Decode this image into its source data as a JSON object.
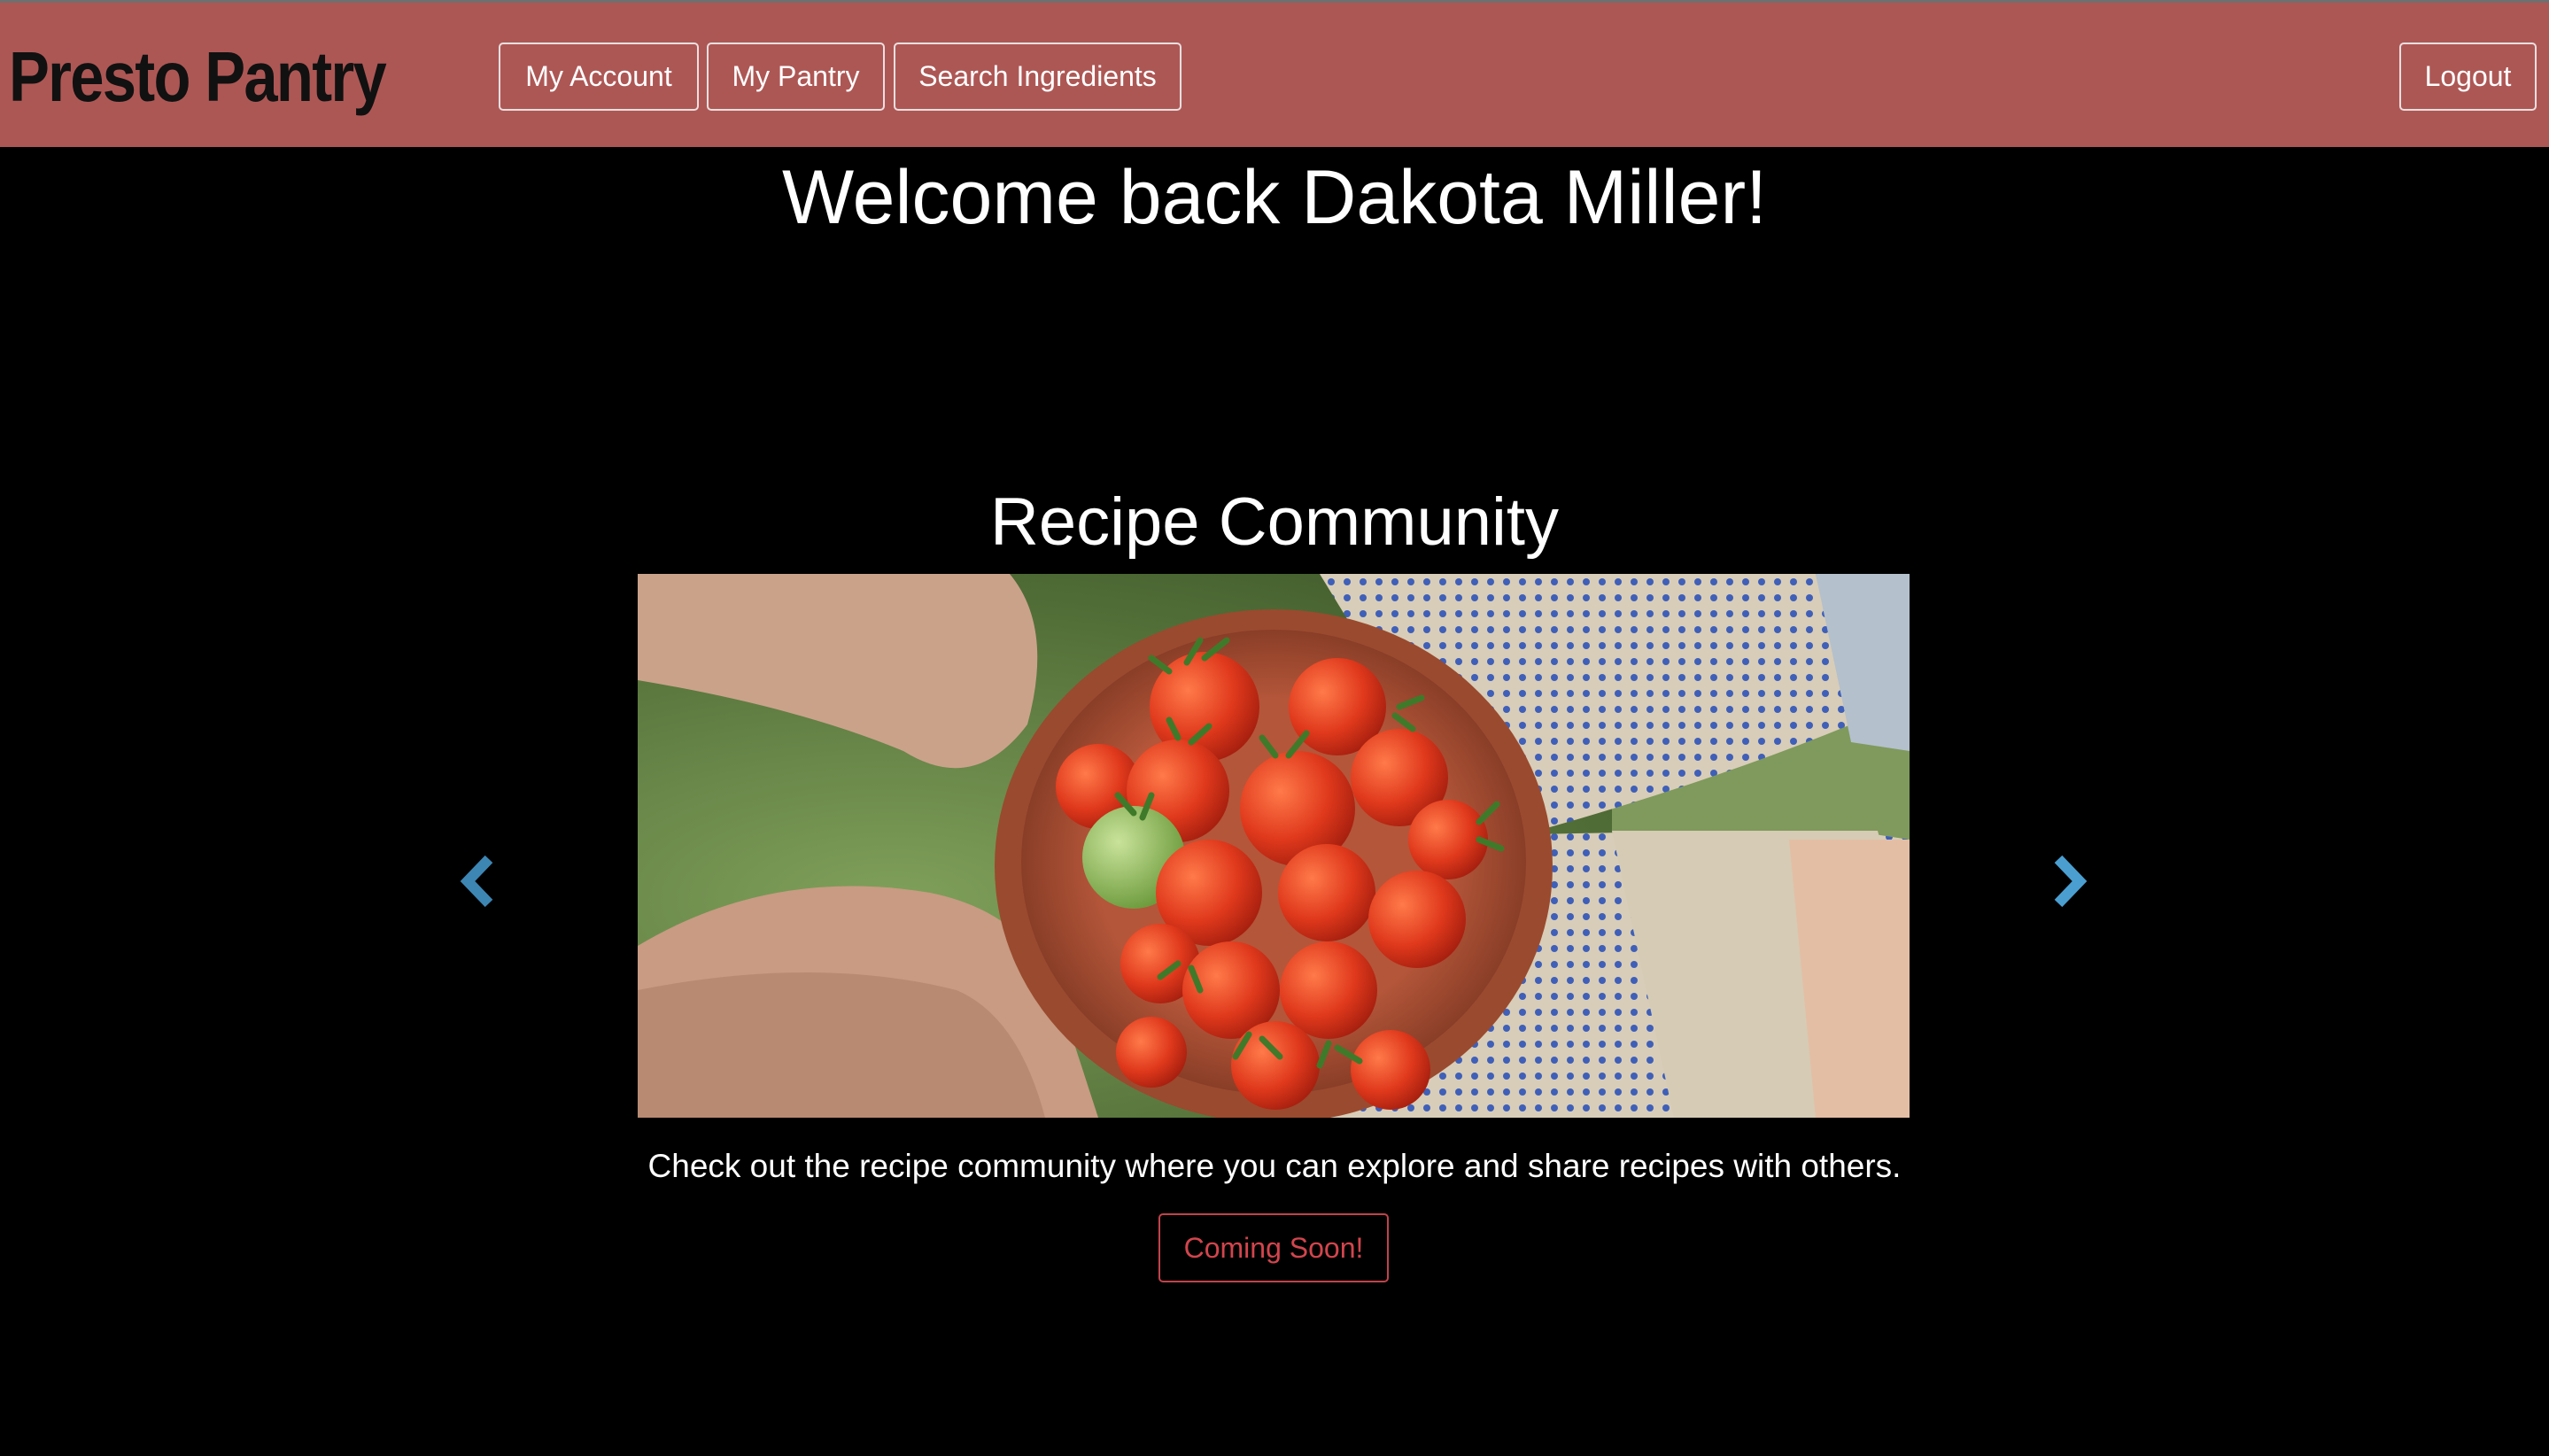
{
  "brand": {
    "title": "Presto Pantry"
  },
  "nav": {
    "my_account": "My Account",
    "my_pantry": "My Pantry",
    "search_ingredients": "Search Ingredients",
    "logout": "Logout"
  },
  "main": {
    "welcome": "Welcome back Dakota Miller!",
    "section_title": "Recipe Community",
    "carousel": {
      "prev_icon": "chevron-left-icon",
      "next_icon": "chevron-right-icon",
      "image_subject": "hands holding a clay bowl of cherry tomatoes"
    },
    "caption": "Check out the recipe community where you can explore and share recipes with others.",
    "cta_label": "Coming Soon!"
  },
  "colors": {
    "navbar": "#ad5755",
    "background": "#000000",
    "cta": "#d2454d",
    "arrow": "#4a9fd0"
  }
}
